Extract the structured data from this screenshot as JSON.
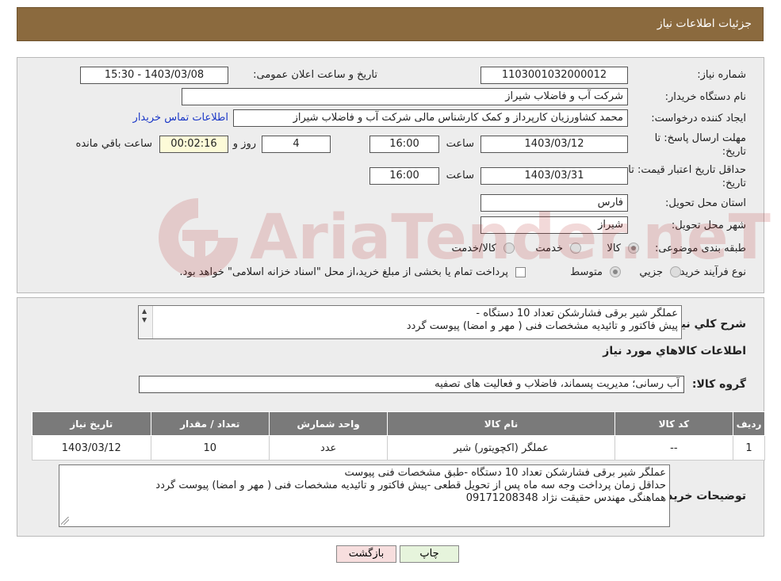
{
  "header": {
    "title": "جزئیات اطلاعات نیاز"
  },
  "form": {
    "need_number_label": "شماره نیاز:",
    "need_number": "1103001032000012",
    "announce_label": "تاریخ و ساعت اعلان عمومی:",
    "announce_value": "1403/03/08 - 15:30",
    "buyer_org_label": "نام دستگاه خریدار:",
    "buyer_org": "شرکت آب و فاضلاب شیراز",
    "creator_label": "ایجاد کننده درخواست:",
    "creator": "محمد کشاورزیان کارپرداز و کمک کارشناس مالی شرکت آب و فاضلاب شیراز",
    "contact_link": "اطلاعات تماس خریدار",
    "reply_deadline_label": "مهلت ارسال پاسخ: تا تاریخ:",
    "reply_date": "1403/03/12",
    "time_label": "ساعت",
    "reply_time": "16:00",
    "days": "4",
    "days_label": "روز و",
    "remaining": "00:02:16",
    "remaining_label": "ساعت باقي مانده",
    "price_validity_label": "حداقل تاریخ اعتبار قیمت: تا تاریخ:",
    "price_date": "1403/03/31",
    "price_time": "16:00",
    "province_label": "استان محل تحویل:",
    "province": "فارس",
    "city_label": "شهر محل تحویل:",
    "city": "شیراز",
    "category_label": "طبقه بندی موضوعی:",
    "category_options": [
      "کالا",
      "خدمت",
      "کالا/خدمت"
    ],
    "process_label": "نوع فرآیند خرید :",
    "process_options": [
      "جزیي",
      "متوسط"
    ],
    "payment_note": "پرداخت تمام یا بخشی از مبلغ خرید،از محل \"اسناد خزانه اسلامی\" خواهد بود."
  },
  "details": {
    "summary_label": "شرح كلي نياز:",
    "summary_lines": [
      "عملگر شیر برقی فشارشکن تعداد 10 دستگاه -",
      "پیش فاکتور و تائیدیه مشخصات فنی ( مهر و امضا) پیوست گردد"
    ],
    "goods_info_title": "اطلاعات كالاهاي مورد نياز",
    "group_label": "گروه کالا:",
    "group_value": "آب رسانی؛ مدیریت پسماند، فاضلاب و فعالیت های تصفیه",
    "table_headers": [
      "رديف",
      "کد کالا",
      "نام کالا",
      "واحد شمارش",
      "تعداد / مقدار",
      "تاریخ نیاز"
    ],
    "table_rows": [
      [
        "1",
        "--",
        "عملگر (اکچویتور) شیر",
        "عدد",
        "10",
        "1403/03/12"
      ]
    ],
    "buyer_notes_label": "توضیحات خریدار:",
    "buyer_notes_lines": [
      "عملگر شیر برقی فشارشکن تعداد 10 دستگاه -طبق مشخصات فنی پیوست",
      "حداقل زمان پرداخت وجه سه ماه پس از تحویل قطعی -پیش فاکتور و تائیدیه مشخصات فنی ( مهر و امضا) پیوست گردد",
      "هماهنگی مهندس حقیقت نژاد 09171208348"
    ]
  },
  "buttons": {
    "print": "چاپ",
    "back": "بازگشت"
  },
  "watermark": "AriaTender.neT",
  "colors": {
    "header_bg": "#8b6a3e",
    "table_header_bg": "#7a7a7a",
    "link": "#1a37c7"
  }
}
